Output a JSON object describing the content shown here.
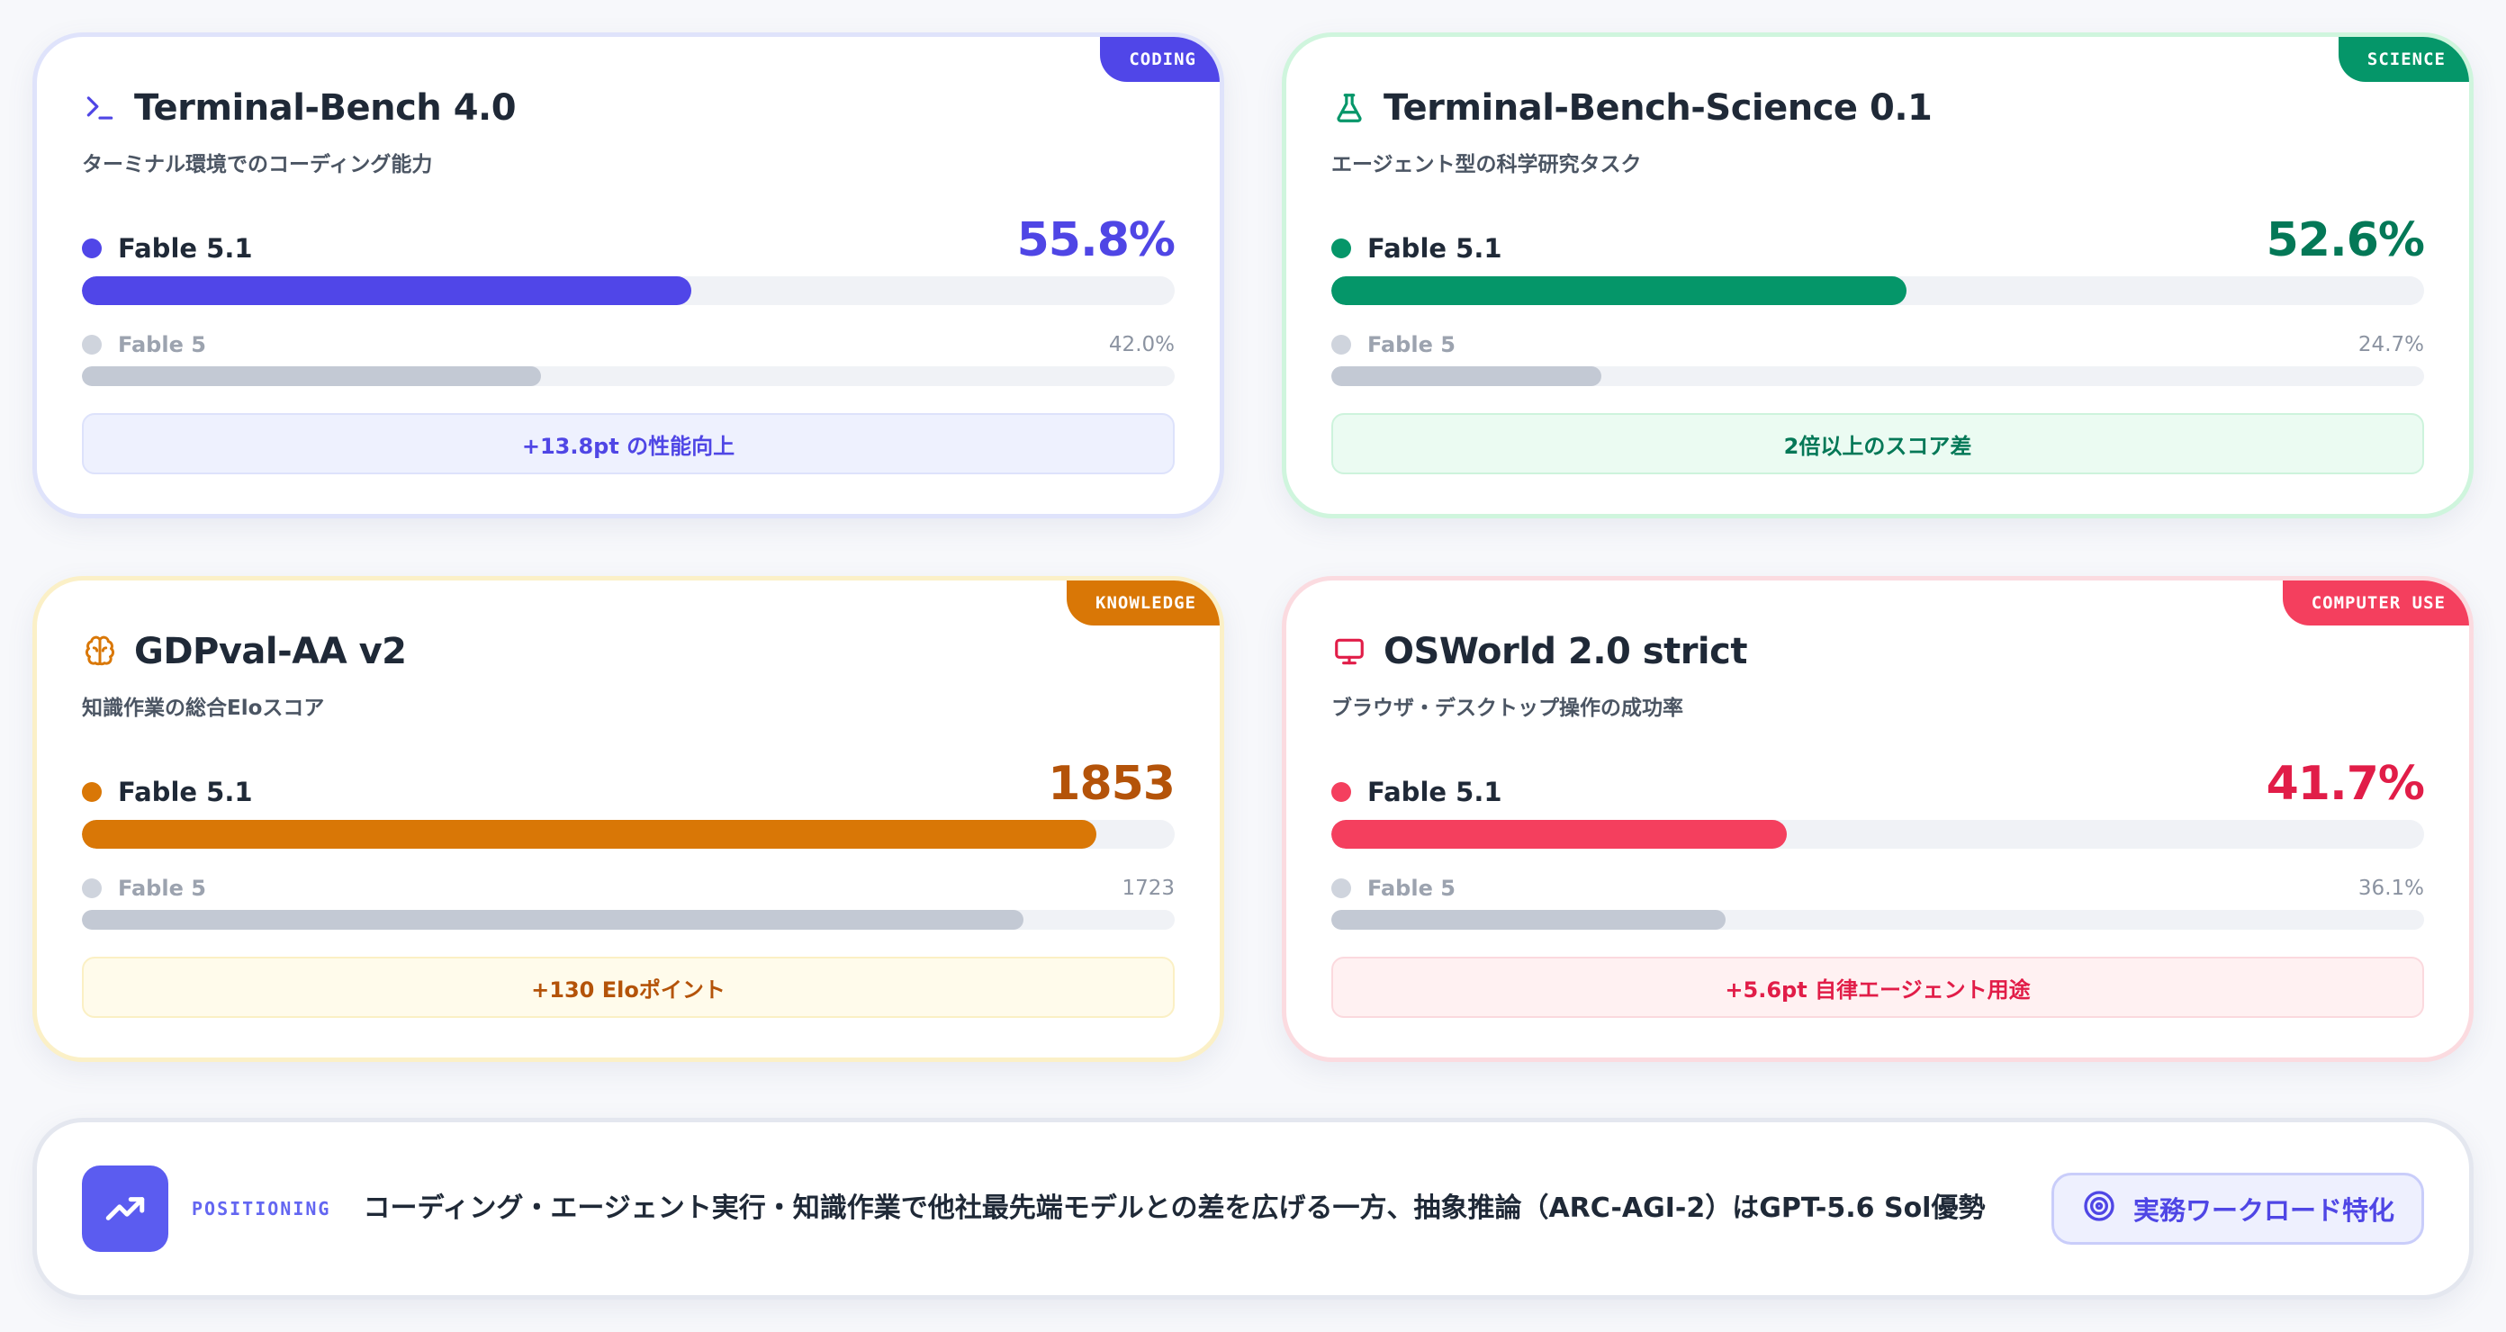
{
  "cards": [
    {
      "tag": "CODING",
      "title": "Terminal-Bench 4.0",
      "subtitle": "ターミナル環境でのコーディング能力",
      "icon": "terminal-icon",
      "main_label": "Fable 5.1",
      "main_value": "55.8%",
      "main_fraction": 0.558,
      "sub_label": "Fable 5",
      "sub_value": "42.0%",
      "sub_fraction": 0.42,
      "note": "+13.8pt の性能向上",
      "colors": {
        "accent": "#4f46e5",
        "bar": "#5046e8",
        "note_bg": "#eef1fe",
        "note_border": "#dde2fb",
        "note_text": "#4f46e5"
      }
    },
    {
      "tag": "SCIENCE",
      "title": "Terminal-Bench-Science 0.1",
      "subtitle": "エージェント型の科学研究タスク",
      "icon": "flask-icon",
      "main_label": "Fable 5.1",
      "main_value": "52.6%",
      "main_fraction": 0.526,
      "sub_label": "Fable 5",
      "sub_value": "24.7%",
      "sub_fraction": 0.247,
      "note": "2倍以上のスコア差",
      "colors": {
        "accent": "#047857",
        "bar": "#059669",
        "note_bg": "#ebfbf2",
        "note_border": "#cdf3dc",
        "note_text": "#047857"
      }
    },
    {
      "tag": "KNOWLEDGE",
      "title": "GDPval-AA v2",
      "subtitle": "知識作業の総合Eloスコア",
      "icon": "brain-icon",
      "main_label": "Fable 5.1",
      "main_value": "1853",
      "main_fraction": 0.928,
      "sub_label": "Fable 5",
      "sub_value": "1723",
      "sub_fraction": 0.862,
      "note": "+130 Eloポイント",
      "colors": {
        "accent": "#b45309",
        "bar": "#d97706",
        "note_bg": "#fffbeb",
        "note_border": "#fbf0c4",
        "note_text": "#b45309"
      }
    },
    {
      "tag": "COMPUTER USE",
      "title": "OSWorld 2.0 strict",
      "subtitle": "ブラウザ・デスクトップ操作の成功率",
      "icon": "monitor-icon",
      "main_label": "Fable 5.1",
      "main_value": "41.7%",
      "main_fraction": 0.417,
      "sub_label": "Fable 5",
      "sub_value": "36.1%",
      "sub_fraction": 0.361,
      "note": "+5.6pt 自律エージェント用途",
      "colors": {
        "accent": "#e11d48",
        "bar": "#f43f5e",
        "note_bg": "#fff1f2",
        "note_border": "#fbd9de",
        "note_text": "#e11d48"
      }
    }
  ],
  "positioning": {
    "kicker": "POSITIONING",
    "text": "コーディング・エージェント実行・知識作業で他社最先端モデルとの差を広げる一方、抽象推論（ARC-AGI-2）はGPT-5.6 Sol優勢",
    "badge": "実務ワークロード特化",
    "icon": "trending-up-icon",
    "badge_icon": "target-icon"
  }
}
